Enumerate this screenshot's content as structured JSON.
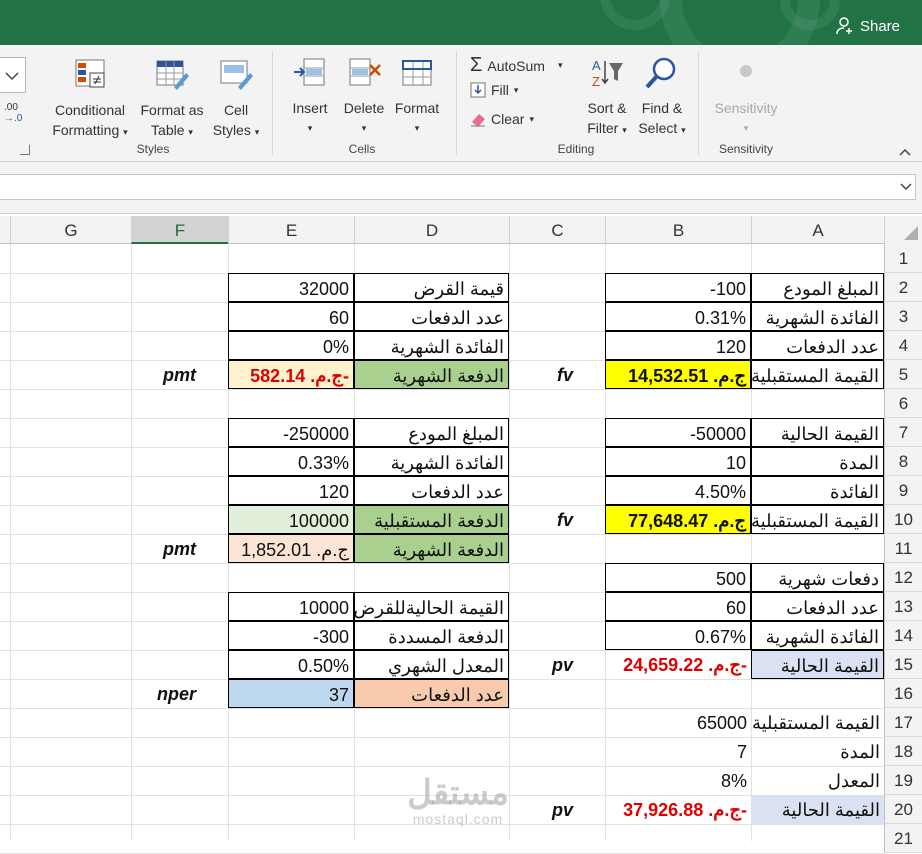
{
  "titlebar": {
    "share": "Share"
  },
  "ribbon": {
    "styles": {
      "conditional": "Conditional",
      "conditional2": "Formatting",
      "format_table": "Format as",
      "format_table2": "Table",
      "cell_styles": "Cell",
      "cell_styles2": "Styles",
      "label": "Styles"
    },
    "cells": {
      "insert": "Insert",
      "delete": "Delete",
      "format": "Format",
      "label": "Cells"
    },
    "editing": {
      "autosum": "AutoSum",
      "fill": "Fill",
      "clear": "Clear",
      "sort": "Sort &",
      "sort2": "Filter",
      "find": "Find &",
      "find2": "Select",
      "label": "Editing"
    },
    "sensitivity": {
      "button": "Sensitivity",
      "label": "Sensitivity"
    },
    "number_fmt": ".00",
    "number_fmt2": "→.0"
  },
  "columns": [
    "A",
    "B",
    "C",
    "D",
    "E",
    "F",
    "G"
  ],
  "rows": [
    "1",
    "2",
    "3",
    "4",
    "5",
    "6",
    "7",
    "8",
    "9",
    "10",
    "11",
    "12",
    "13",
    "14",
    "15",
    "16",
    "17",
    "18",
    "19",
    "20",
    "21"
  ],
  "cells": {
    "a2": "المبلغ المودع",
    "b2": "-100",
    "a3": "الفائدة الشهرية",
    "b3": "0.31%",
    "a4": "عدد الدفعات",
    "b4": "120",
    "a5": "القيمة المستقبلية",
    "b5": "ج.م. 14,532.51",
    "c5": "fv",
    "a7": "القيمة الحالية",
    "b7": "-50000",
    "a8": "المدة",
    "b8": "10",
    "a9": "الفائدة",
    "b9": "4.50%",
    "a10": "القيمة المستقبلية",
    "b10": "ج.م. 77,648.47",
    "c10": "fv",
    "a12": "دفعات شهرية",
    "b12": "500",
    "a13": "عدد الدفعات",
    "b13": "60",
    "a14": "الفائدة الشهرية",
    "b14": "0.67%",
    "a15": "القيمة الحالية",
    "b15": "ج.م. 24,659.22-",
    "c15": "pv",
    "a17": "القيمة المستقبلية",
    "b17": "65000",
    "a18": "المدة",
    "b18": "7",
    "a19": "المعدل",
    "b19": "8%",
    "a20": "القيمة الحالية",
    "b20": "ج.م. 37,926.88-",
    "c20": "pv",
    "d2": "قيمة القرض",
    "e2": "32000",
    "d3": "عدد الدفعات",
    "e3": "60",
    "d4": "الفائدة الشهرية",
    "e4": "0%",
    "d5": "الدفعة الشهرية",
    "e5": "ج.م. 582.14-",
    "f5": "pmt",
    "d7": "المبلغ المودع",
    "e7": "-250000",
    "d8": "الفائدة الشهرية",
    "e8": "0.33%",
    "d9": "عدد الدفعات",
    "e9": "120",
    "d10": "الدفعة المستقبلية",
    "e10": "100000",
    "d11": "الدفعة الشهرية",
    "e11": "ج.م. 1,852.01",
    "f11": "pmt",
    "d13": "القيمة الحاليةللقرض",
    "e13": "10000",
    "d14": "الدفعة المسددة",
    "e14": "-300",
    "d15": "المعدل الشهري",
    "e15": "0.50%",
    "d16": "عدد الدفعات",
    "e16": "37",
    "f16": "nper"
  },
  "watermark": {
    "arabic": "مستقل",
    "latin": "mostaql.com"
  },
  "colors": {
    "excel_green": "#217346",
    "yellow": "#ffff00",
    "green_fill": "#a9d08e",
    "light_green": "#e2efda",
    "peach": "#fce4d6",
    "light_orange": "#fff2cc",
    "blue": "#bdd7ee",
    "lavender": "#d9e1f2",
    "orange": "#f8cbad",
    "red_text": "#e00000"
  }
}
